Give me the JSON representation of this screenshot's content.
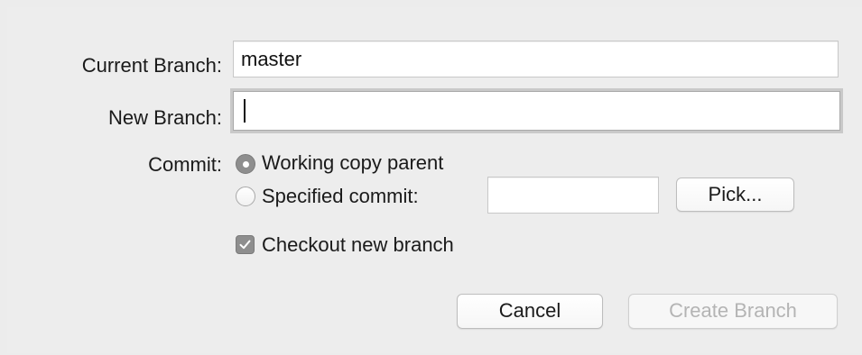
{
  "form": {
    "current_branch": {
      "label": "Current Branch:",
      "value": "master"
    },
    "new_branch": {
      "label": "New Branch:",
      "value": ""
    },
    "commit": {
      "label": "Commit:",
      "options": [
        {
          "label": "Working copy parent",
          "selected": true
        },
        {
          "label": "Specified commit:",
          "selected": false
        }
      ],
      "specified_commit_value": "",
      "pick_label": "Pick..."
    },
    "checkout": {
      "label": "Checkout new branch",
      "checked": true
    }
  },
  "buttons": {
    "cancel_label": "Cancel",
    "create_label": "Create Branch",
    "create_enabled": false
  }
}
